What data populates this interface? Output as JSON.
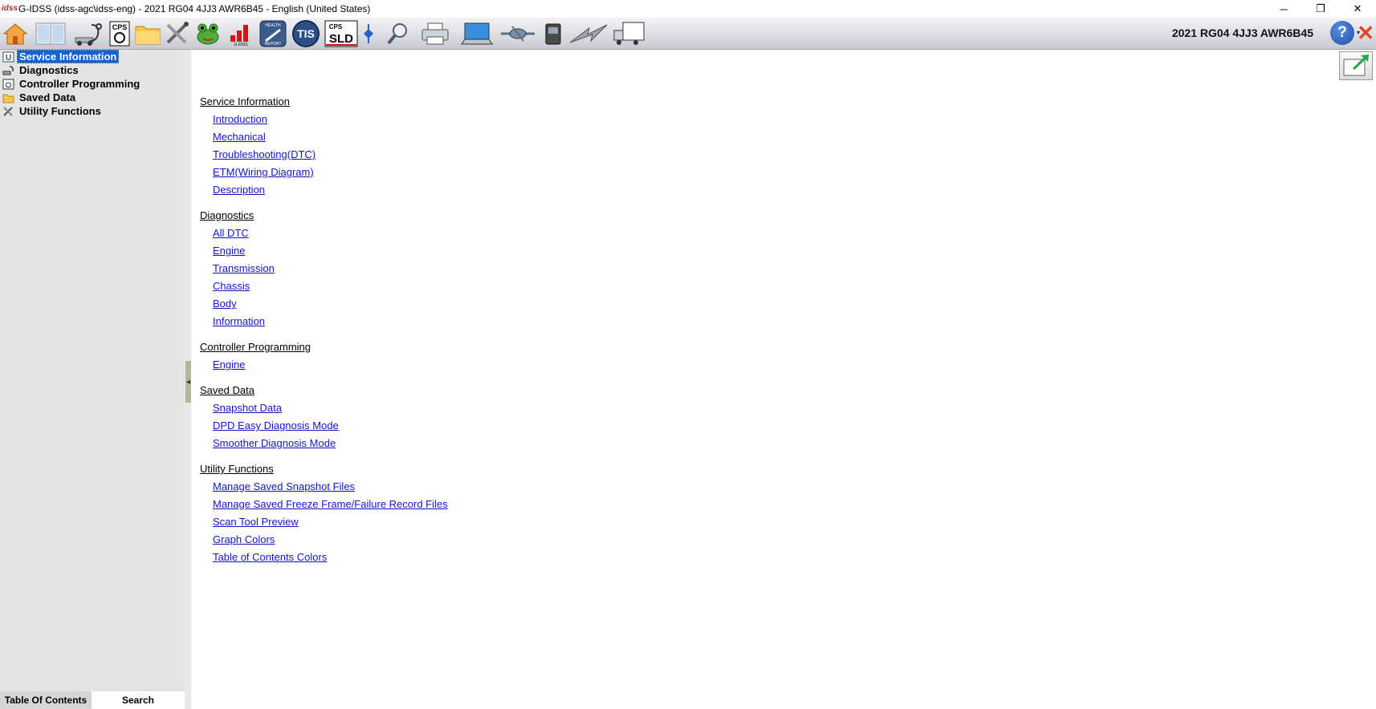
{
  "window": {
    "title": "G-IDSS (idss-agc\\idss-eng) - 2021 RG04 4JJ3 AWR6B45 - English (United States)",
    "logo_text": "idss",
    "minimize": "─",
    "restore": "❐",
    "close": "✕"
  },
  "toolbar": {
    "vehicle": "2021 RG04 4JJ3 AWR6B45",
    "help_label": "?",
    "help_caret": "▾",
    "icons": [
      {
        "name": "home-icon"
      },
      {
        "name": "book-icon"
      },
      {
        "name": "diagnostics-stethoscope-icon"
      },
      {
        "name": "cps-programming-icon",
        "text": "CPS"
      },
      {
        "name": "folder-icon"
      },
      {
        "name": "tools-icon"
      },
      {
        "name": "frog-icon"
      },
      {
        "name": "bar-chart-icon",
        "text": "G-IDSS"
      },
      {
        "name": "health-report-icon",
        "text": "HEALTH REPORT"
      },
      {
        "name": "tis-icon",
        "text": "TIS"
      },
      {
        "name": "cps-sld-icon",
        "text": "SLD"
      },
      {
        "name": "split-arrow-icon"
      },
      {
        "name": "magnifier-icon"
      },
      {
        "name": "printer-icon"
      },
      {
        "name": "laptop-icon"
      },
      {
        "name": "network-icon"
      },
      {
        "name": "device-icon"
      },
      {
        "name": "lightning-icon"
      },
      {
        "name": "truck-icon"
      }
    ]
  },
  "sidebar": {
    "items": [
      {
        "label": "Service Information",
        "icon": "book-icon",
        "selected": true
      },
      {
        "label": "Diagnostics",
        "icon": "diagnostics-icon",
        "selected": false
      },
      {
        "label": "Controller Programming",
        "icon": "cps-icon",
        "selected": false
      },
      {
        "label": "Saved Data",
        "icon": "folder-icon",
        "selected": false
      },
      {
        "label": "Utility Functions",
        "icon": "tools-icon",
        "selected": false
      }
    ],
    "tabs": [
      {
        "label": "Table Of Contents",
        "active": false
      },
      {
        "label": "Search",
        "active": true
      }
    ]
  },
  "content": {
    "sections": [
      {
        "heading": "Service Information",
        "links": [
          "Introduction",
          "Mechanical",
          "Troubleshooting(DTC)",
          "ETM(Wiring Diagram)",
          "Description"
        ]
      },
      {
        "heading": "Diagnostics",
        "links": [
          "All DTC",
          "Engine",
          "Transmission",
          "Chassis",
          "Body",
          "Information"
        ]
      },
      {
        "heading": "Controller Programming",
        "links": [
          "Engine"
        ]
      },
      {
        "heading": "Saved Data",
        "links": [
          "Snapshot Data",
          "DPD Easy Diagnosis Mode",
          "Smoother Diagnosis Mode"
        ]
      },
      {
        "heading": "Utility Functions",
        "links": [
          "Manage Saved Snapshot Files",
          "Manage Saved Freeze Frame/Failure Record Files",
          "Scan Tool Preview",
          "Graph Colors",
          "Table of Contents Colors"
        ]
      }
    ]
  },
  "colors": {
    "link": "#1515c7",
    "selection": "#0a64d6",
    "sidebar_bg": "#e4e4e4"
  }
}
